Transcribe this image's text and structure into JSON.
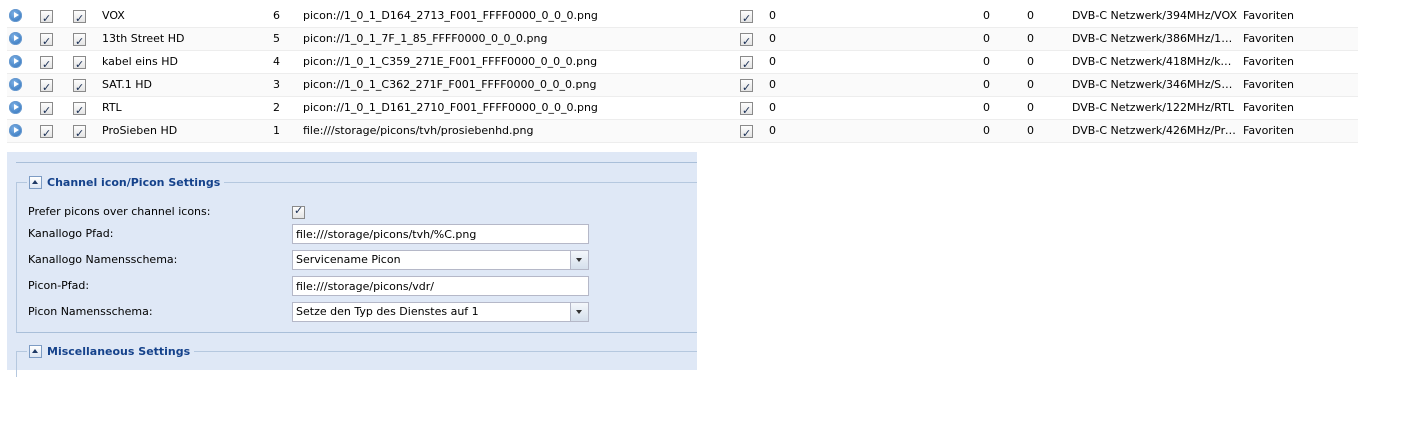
{
  "grid": {
    "rows": [
      {
        "name": "VOX",
        "number": "6",
        "icon": "picon://1_0_1_D164_2713_F001_FFFF0000_0_0_0.png",
        "v1": "0",
        "v2": "0",
        "v3": "0",
        "service": "DVB-C Netzwerk/394MHz/VOX",
        "tag": "Favoriten"
      },
      {
        "name": "13th Street HD",
        "number": "5",
        "icon": "picon://1_0_1_7F_1_85_FFFF0000_0_0_0.png",
        "v1": "0",
        "v2": "0",
        "v3": "0",
        "service": "DVB-C Netzwerk/386MHz/13t...",
        "tag": "Favoriten"
      },
      {
        "name": "kabel eins HD",
        "number": "4",
        "icon": "picon://1_0_1_C359_271E_F001_FFFF0000_0_0_0.png",
        "v1": "0",
        "v2": "0",
        "v3": "0",
        "service": "DVB-C Netzwerk/418MHz/kab...",
        "tag": "Favoriten"
      },
      {
        "name": "SAT.1 HD",
        "number": "3",
        "icon": "picon://1_0_1_C362_271F_F001_FFFF0000_0_0_0.png",
        "v1": "0",
        "v2": "0",
        "v3": "0",
        "service": "DVB-C Netzwerk/346MHz/SAT...",
        "tag": "Favoriten"
      },
      {
        "name": "RTL",
        "number": "2",
        "icon": "picon://1_0_1_D161_2710_F001_FFFF0000_0_0_0.png",
        "v1": "0",
        "v2": "0",
        "v3": "0",
        "service": "DVB-C Netzwerk/122MHz/RTL",
        "tag": "Favoriten"
      },
      {
        "name": "ProSieben HD",
        "number": "1",
        "icon": "file:///storage/picons/tvh/prosiebenhd.png",
        "v1": "0",
        "v2": "0",
        "v3": "0",
        "service": "DVB-C Netzwerk/426MHz/Pro...",
        "tag": "Favoriten"
      }
    ]
  },
  "settings": {
    "picon_section": {
      "title": "Channel icon/Picon Settings",
      "prefer_picons_label": "Prefer picons over channel icons:",
      "channel_icon_path_label": "Kanallogo Pfad:",
      "channel_icon_path_value": "file:///storage/picons/tvh/%C.png",
      "channel_icon_scheme_label": "Kanallogo Namensschema:",
      "channel_icon_scheme_value": "Servicename Picon",
      "picon_path_label": "Picon-Pfad:",
      "picon_path_value": "file:///storage/picons/vdr/",
      "picon_scheme_label": "Picon Namensschema:",
      "picon_scheme_value": "Setze den Typ des Dienstes auf 1"
    },
    "misc_section": {
      "title": "Miscellaneous Settings"
    }
  }
}
